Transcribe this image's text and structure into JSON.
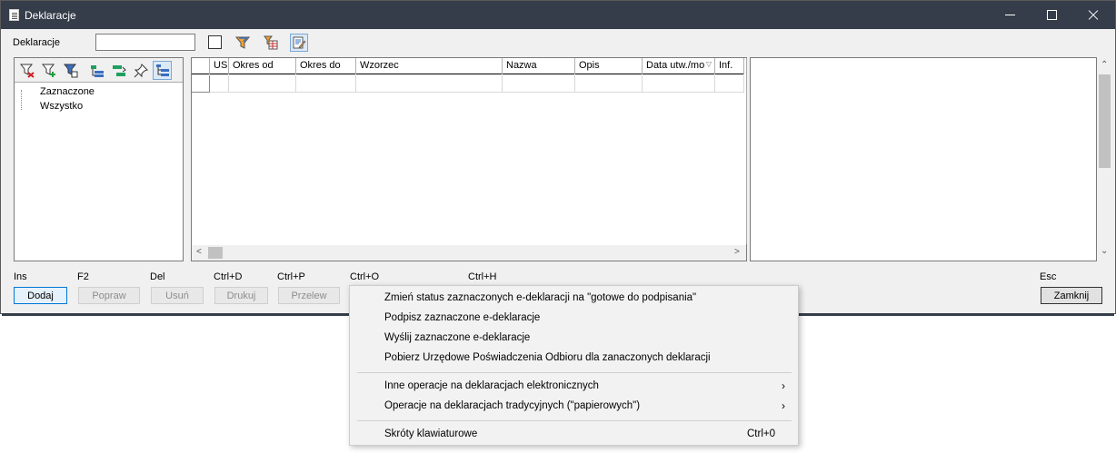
{
  "window": {
    "title": "Deklaracje"
  },
  "filter": {
    "label": "Deklaracje",
    "input_value": "",
    "input_placeholder": ""
  },
  "tree": {
    "items": [
      "Zaznaczone",
      "Wszystko"
    ]
  },
  "grid": {
    "columns": [
      "US",
      "Okres od",
      "Okres do",
      "Wzorzec",
      "Nazwa",
      "Opis",
      "Data utw./mo",
      "Inf."
    ]
  },
  "actions": [
    {
      "shortcut": "Ins",
      "label": "Dodaj",
      "enabled": true
    },
    {
      "shortcut": "F2",
      "label": "Popraw",
      "enabled": false
    },
    {
      "shortcut": "Del",
      "label": "Usuń",
      "enabled": false
    },
    {
      "shortcut": "Ctrl+D",
      "label": "Drukuj",
      "enabled": false
    },
    {
      "shortcut": "Ctrl+P",
      "label": "Przelew",
      "enabled": false
    },
    {
      "shortcut": "Ctrl+O",
      "label": "",
      "enabled": false
    },
    {
      "shortcut": "Ctrl+H",
      "label": "",
      "enabled": false
    }
  ],
  "close_action": {
    "shortcut": "Esc",
    "label": "Zamknij"
  },
  "context_menu": {
    "items": [
      "Zmień status zaznaczonych e-deklaracji na \"gotowe do podpisania\"",
      "Podpisz zaznaczone e-deklaracje",
      "Wyślij zaznaczone e-deklaracje",
      "Pobierz Urzędowe Poświadczenia Odbioru dla zanaczonych deklaracji"
    ],
    "submenus": [
      "Inne operacje na deklaracjach elektronicznych",
      "Operacje na deklaracjach tradycyjnych (\"papierowych\")"
    ],
    "shortcuts_item": {
      "label": "Skróty klawiaturowe",
      "shortcut": "Ctrl+0"
    }
  },
  "colors": {
    "titlebar": "#353d4a",
    "accent": "#0078d7"
  },
  "icons": {
    "toolbar": [
      "filter-icon",
      "filter-table-icon",
      "edit-icon"
    ],
    "tree_toolbar": [
      "filter-remove-icon",
      "filter-add-icon",
      "filter-edit-icon",
      "tree-expand-icon",
      "tree-collapse-icon",
      "pin-icon",
      "tree-view-icon"
    ]
  }
}
